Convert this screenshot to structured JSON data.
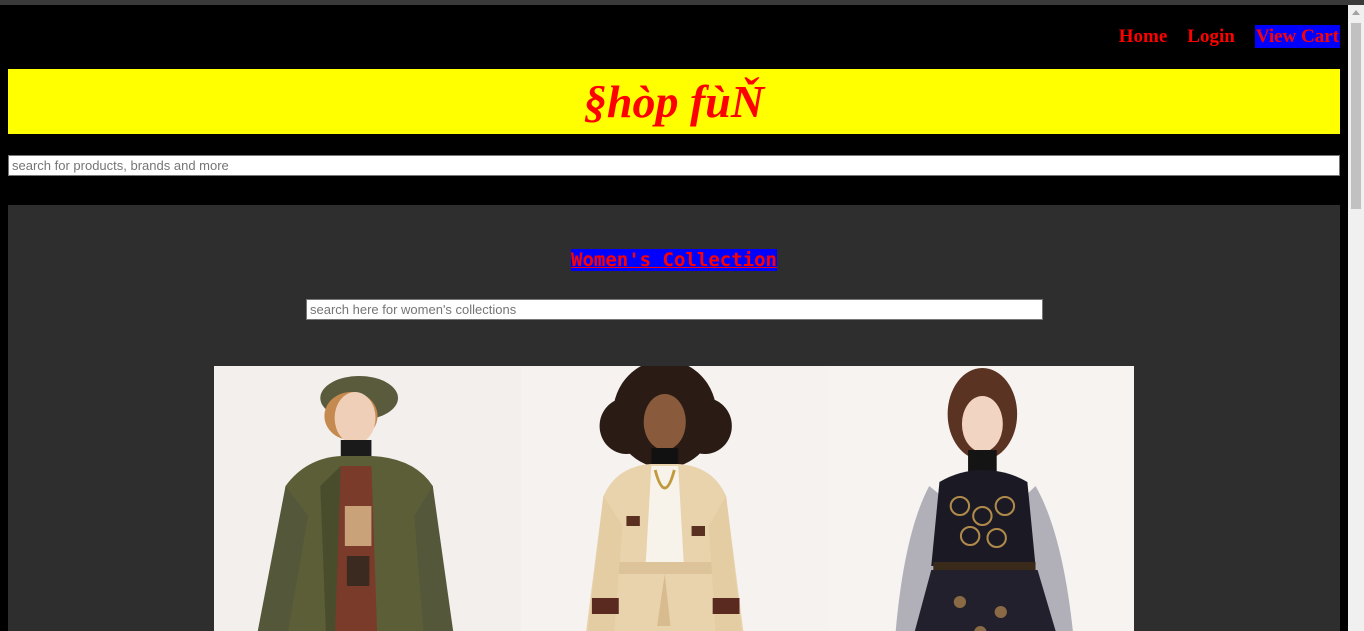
{
  "nav": {
    "home_label": "Home",
    "login_label": "Login",
    "cart_label": "View Cart"
  },
  "brand": {
    "title": "§hòp fùŇ"
  },
  "search": {
    "placeholder": "search for products, brands and more"
  },
  "collection": {
    "title": "Women's Collection",
    "search_placeholder": "search here for women's collections"
  },
  "colors": {
    "page_bg": "#000000",
    "brand_bar": "#ffff00",
    "text_red": "#ff0000",
    "highlight_blue": "#0000ff",
    "panel_bg": "#2e2e2e"
  }
}
